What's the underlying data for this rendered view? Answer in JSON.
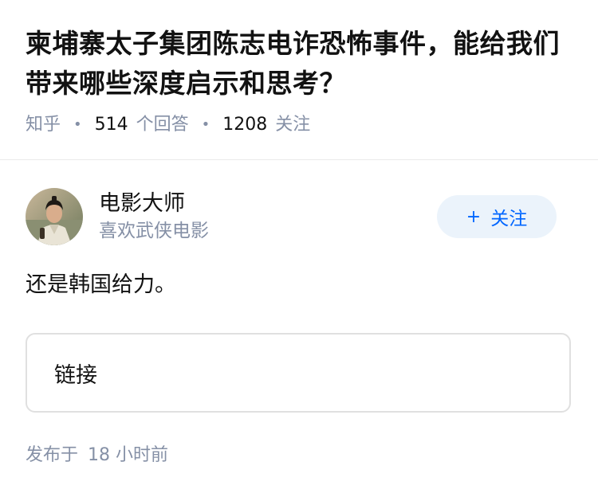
{
  "question": {
    "title": "柬埔寨太子集团陈志电诈恐怖事件，能给我们带来哪些深度启示和思考？",
    "source": "知乎",
    "answer_count": "514",
    "answer_label": "个回答",
    "follow_count": "1208",
    "follow_label": "关注"
  },
  "author": {
    "name": "电影大师",
    "bio": "喜欢武侠电影",
    "follow_button": "关注",
    "follow_icon": "plus-icon"
  },
  "answer": {
    "text": "还是韩国给力。",
    "link_card": "链接"
  },
  "footer": {
    "published_label": "发布于",
    "published_time": "18 小时前"
  },
  "colors": {
    "primary_text": "#121212",
    "meta_text": "#8590a6",
    "follow_button_bg": "#ebf3fb",
    "follow_button_text": "#0066ff",
    "card_border": "#e0e0e0"
  }
}
